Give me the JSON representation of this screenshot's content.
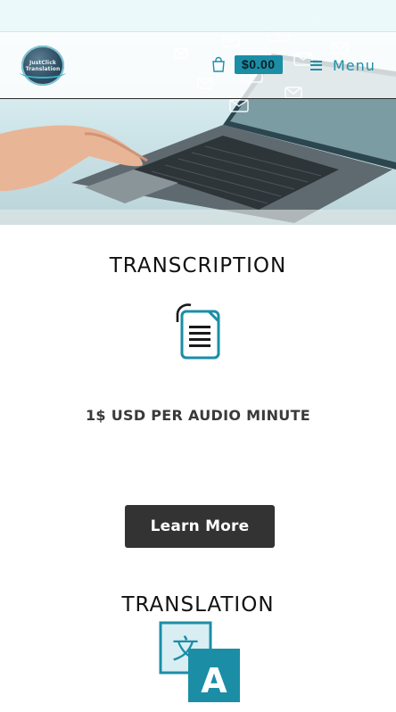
{
  "header": {
    "logo_text_line1": "JustClick",
    "logo_text_line2": "Translation",
    "cart_total": "$0.00",
    "menu_label": "Menu"
  },
  "services": [
    {
      "title": "TRANSCRIPTION",
      "icon": "document-icon",
      "price_note": "1$ USD PER AUDIO MINUTE",
      "button_label": "Learn More"
    },
    {
      "title": "TRANSLATION",
      "icon": "translate-icon"
    }
  ],
  "colors": {
    "accent": "#1e8fa6",
    "button": "#333333",
    "translate_icon_dark": "#1b8ea6",
    "translate_icon_light": "#d8eef3"
  }
}
